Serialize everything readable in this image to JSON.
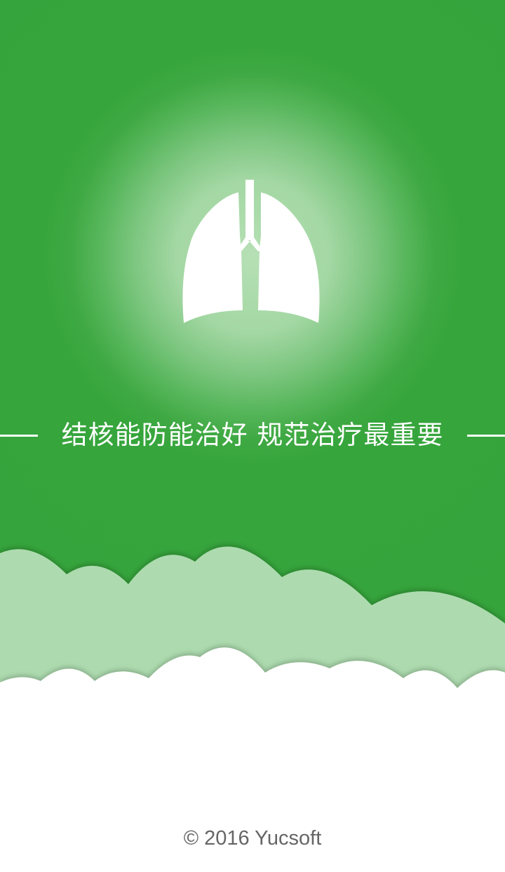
{
  "slogan": "结核能防能治好 规范治疗最重要",
  "copyright": "© 2016 Yucsoft",
  "icons": {
    "main": "lungs-icon"
  },
  "colors": {
    "background_green": "#36a53c",
    "glow": "#b6e0b5",
    "cloud_light": "#addbaf",
    "cloud_white": "#ffffff",
    "text_white": "#ffffff",
    "copyright_text": "#666666"
  }
}
